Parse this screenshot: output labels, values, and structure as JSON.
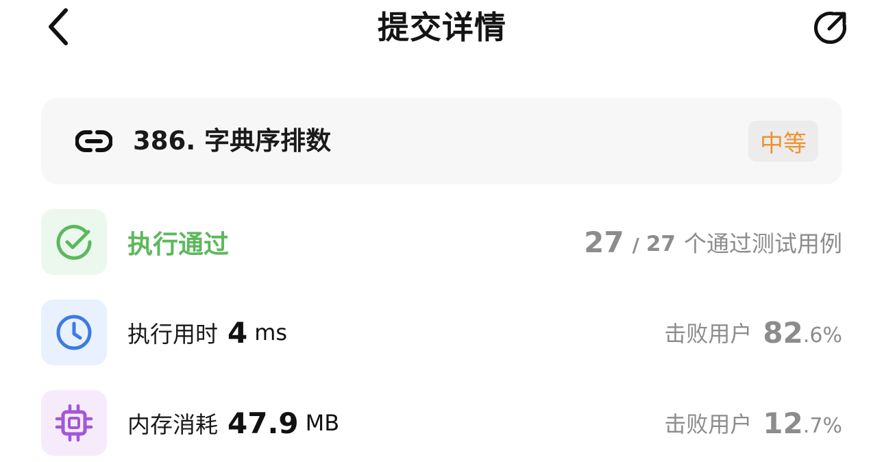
{
  "header": {
    "title": "提交详情",
    "back_icon": "chevron-left-icon",
    "share_icon": "share-icon"
  },
  "problem": {
    "title": "386. 字典序排数",
    "difficulty": "中等",
    "link_icon": "link-icon",
    "difficulty_color": "#f0922f"
  },
  "result": {
    "status": "执行通过",
    "passed": "27",
    "separator": "/",
    "total": "27",
    "caption": "个通过测试用例",
    "icon": "check-circle-icon",
    "color": "#5cb85c"
  },
  "runtime": {
    "label": "执行用时",
    "value": "4",
    "unit": "ms",
    "beat_label": "击败用户",
    "beat_int": "82",
    "beat_frac": ".6%",
    "icon": "clock-icon",
    "color": "#3d7be3"
  },
  "memory": {
    "label": "内存消耗",
    "value": "47.9",
    "unit": "MB",
    "beat_label": "击败用户",
    "beat_int": "12",
    "beat_frac": ".7%",
    "icon": "cpu-chip-icon",
    "color": "#a357d6"
  }
}
